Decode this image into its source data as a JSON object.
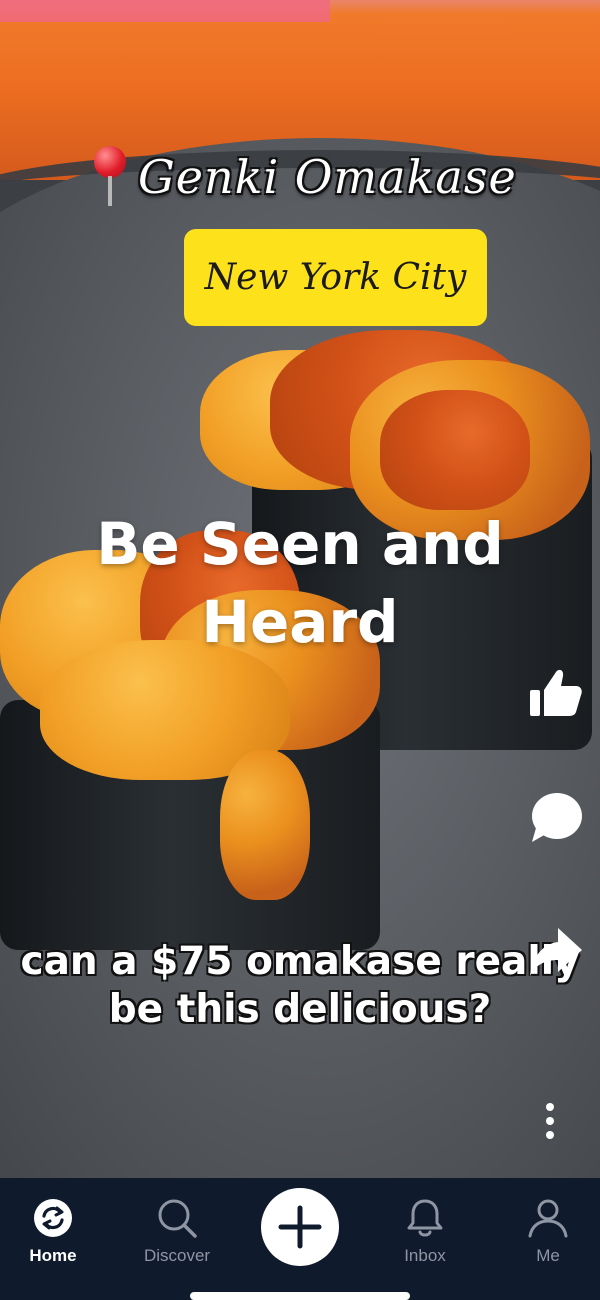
{
  "post": {
    "location_name": "Genki Omakase",
    "city": "New York City",
    "headline_line1": "Be Seen and",
    "headline_line2": "Heard",
    "caption_line1": "can a $75 omakase really",
    "caption_line2": "be this delicious?"
  },
  "side_actions": {
    "like_icon": "thumbs-up-icon",
    "comment_icon": "speech-bubble-icon",
    "share_icon": "share-arrow-icon",
    "more_icon": "vertical-dots-icon"
  },
  "tabbar": {
    "tabs": [
      {
        "label": "Home",
        "icon": "refresh-home-icon",
        "active": true
      },
      {
        "label": "Discover",
        "icon": "search-icon",
        "active": false
      },
      {
        "label": "Inbox",
        "icon": "bell-icon",
        "active": false
      },
      {
        "label": "Me",
        "icon": "person-icon",
        "active": false
      }
    ],
    "create_icon": "plus-icon"
  },
  "colors": {
    "tabbar_bg": "#0f1a2c",
    "city_badge": "#fde21b",
    "inactive_tab": "#8e95a3",
    "active_tab": "#ffffff"
  }
}
